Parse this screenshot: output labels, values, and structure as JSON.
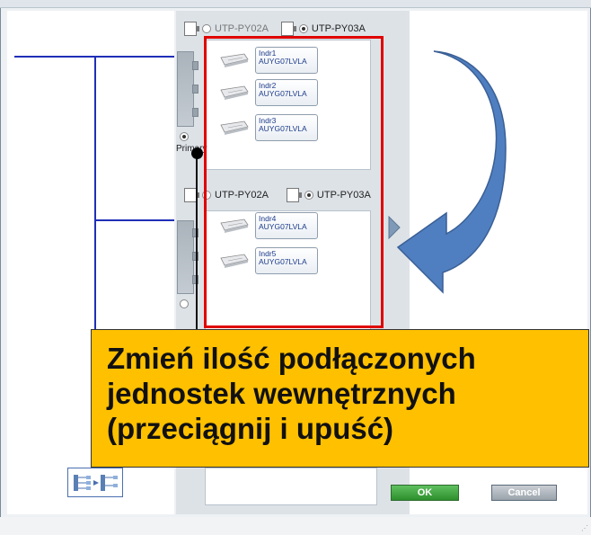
{
  "layout_options": {
    "group1": {
      "option_a": "UTP-PY02A",
      "option_b": "UTP-PY03A",
      "selected": "UTP-PY03A"
    },
    "group2": {
      "option_a": "UTP-PY02A",
      "option_b": "UTP-PY03A",
      "selected": "UTP-PY03A"
    }
  },
  "branch_labels": {
    "primary": "Primary"
  },
  "indoor_units": [
    {
      "name": "Indr1",
      "model": "AUYG07LVLA"
    },
    {
      "name": "Indr2",
      "model": "AUYG07LVLA"
    },
    {
      "name": "Indr3",
      "model": "AUYG07LVLA"
    },
    {
      "name": "Indr4",
      "model": "AUYG07LVLA"
    },
    {
      "name": "Indr5",
      "model": "AUYG07LVLA"
    }
  ],
  "buttons": {
    "ok": "OK",
    "cancel": "Cancel"
  },
  "callout": {
    "line1": "Zmień ilość podłączonych",
    "line2": "jednostek wewnętrznych",
    "line3": "(przeciągnij i upuść)"
  },
  "colors": {
    "highlight_border": "#e00000",
    "callout_bg": "#ffc000",
    "arrow_fill": "#4f7fc0",
    "pipe_line": "#1f2fb7",
    "ok_button": "#3a9f3a"
  },
  "icons": [
    "indoor-unit-icon",
    "curved-arrow-icon",
    "swap-layout-icon",
    "expand-arrow-icon"
  ]
}
